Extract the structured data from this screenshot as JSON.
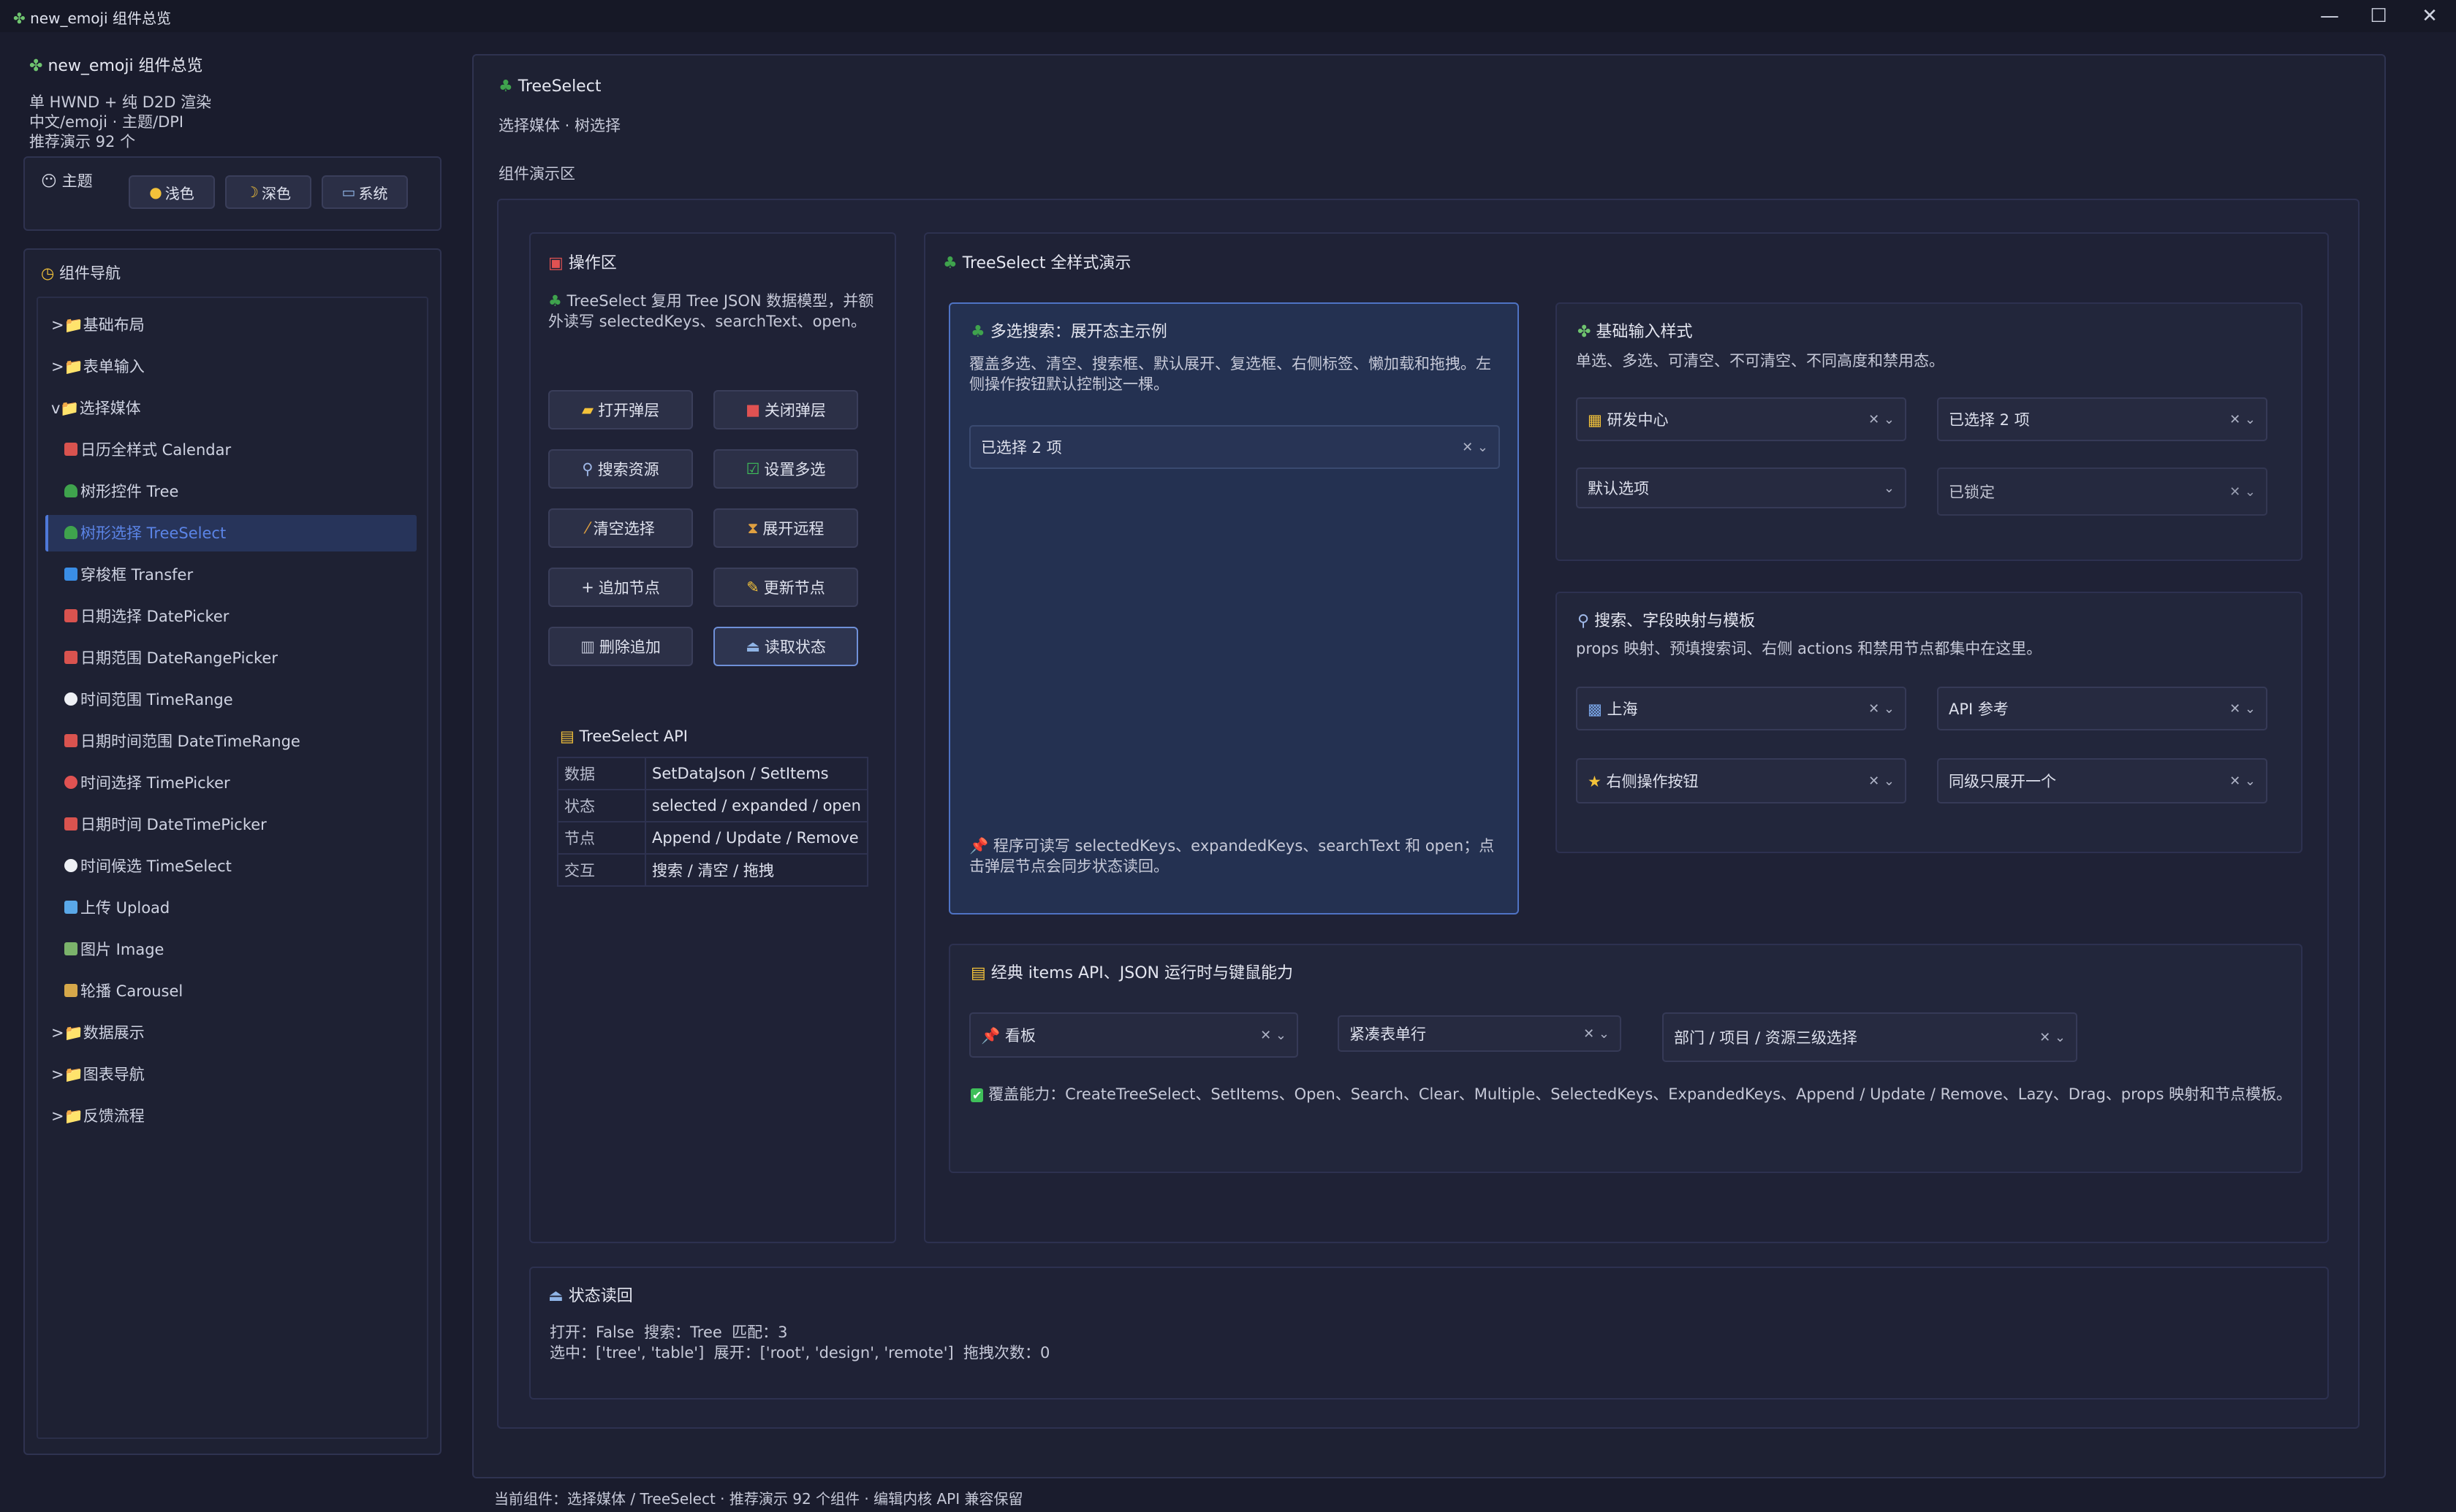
{
  "window": {
    "title": "new_emoji 组件总览",
    "controls": {
      "minimize": "—",
      "maximize": "☐",
      "close": "✕"
    }
  },
  "sidebar": {
    "app_title": "new_emoji 组件总览",
    "subtitle_lines": [
      "单 HWND + 纯 D2D 渲染",
      "中文/emoji · 主题/DPI",
      "推荐演示 92 个"
    ],
    "theme": {
      "label": "主题",
      "options": [
        "浅色",
        "深色",
        "系统"
      ]
    },
    "nav": {
      "title": "组件导航",
      "items": [
        {
          "label": ">📁基础布局",
          "level": 0
        },
        {
          "label": ">📁表单输入",
          "level": 0
        },
        {
          "label": "v📁选择媒体",
          "level": 0
        },
        {
          "label": "日历全样式 Calendar",
          "level": 1,
          "icon": "calendar-icon"
        },
        {
          "label": "树形控件 Tree",
          "level": 1,
          "icon": "tree-icon"
        },
        {
          "label": "树形选择 TreeSelect",
          "level": 1,
          "icon": "tree-icon",
          "selected": true
        },
        {
          "label": "穿梭框 Transfer",
          "level": 1,
          "icon": "transfer-icon"
        },
        {
          "label": "日期选择 DatePicker",
          "level": 1,
          "icon": "calendar-icon"
        },
        {
          "label": "日期范围 DateRangePicker",
          "level": 1,
          "icon": "calendar-icon"
        },
        {
          "label": "时间范围 TimeRange",
          "level": 1,
          "icon": "clock-icon"
        },
        {
          "label": "日期时间范围 DateTimeRange",
          "level": 1,
          "icon": "calendar-icon"
        },
        {
          "label": "时间选择 TimePicker",
          "level": 1,
          "icon": "alarm-icon"
        },
        {
          "label": "日期时间 DateTimePicker",
          "level": 1,
          "icon": "calendar-icon"
        },
        {
          "label": "时间候选 TimeSelect",
          "level": 1,
          "icon": "clock-icon"
        },
        {
          "label": "上传 Upload",
          "level": 1,
          "icon": "upload-icon"
        },
        {
          "label": "图片 Image",
          "level": 1,
          "icon": "image-icon"
        },
        {
          "label": "轮播 Carousel",
          "level": 1,
          "icon": "carousel-icon"
        },
        {
          "label": ">📁数据展示",
          "level": 0
        },
        {
          "label": ">📁图表导航",
          "level": 0
        },
        {
          "label": ">📁反馈流程",
          "level": 0
        }
      ]
    }
  },
  "main": {
    "title": "TreeSelect",
    "subtitle": "选择媒体 · 树选择",
    "demo_area_label": "组件演示区",
    "ops": {
      "title": "操作区",
      "desc": "TreeSelect 复用 Tree JSON 数据模型，并额外读写 selectedKeys、searchText、open。",
      "buttons": [
        "打开弹层",
        "关闭弹层",
        "搜索资源",
        "设置多选",
        "清空选择",
        "展开远程",
        "追加节点",
        "更新节点",
        "删除追加",
        "读取状态"
      ],
      "api": {
        "title": "TreeSelect API",
        "rows": [
          [
            "数据",
            "SetDataJson / SetItems"
          ],
          [
            "状态",
            "selected / expanded / open"
          ],
          [
            "节点",
            "Append / Update / Remove"
          ],
          [
            "交互",
            "搜索 / 清空 / 拖拽"
          ]
        ]
      }
    },
    "demo": {
      "title": "TreeSelect 全样式演示",
      "multi": {
        "title": "多选搜索：展开态主示例",
        "desc": "覆盖多选、清空、搜索框、默认展开、复选框、右侧标签、懒加载和拖拽。左侧操作按钮默认控制这一棵。",
        "value": "已选择 2 项",
        "footer": "程序可读写 selectedKeys、expandedKeys、searchText 和 open；点击弹层节点会同步状态读回。"
      },
      "basic": {
        "title": "基础输入样式",
        "desc": "单选、多选、可清空、不可清空、不同高度和禁用态。",
        "selects": [
          "研发中心",
          "已选择 2 项",
          "默认选项",
          "已锁定"
        ]
      },
      "search": {
        "title": "搜索、字段映射与模板",
        "desc": "props 映射、预填搜索词、右侧 actions 和禁用节点都集中在这里。",
        "selects": [
          "上海",
          "API 参考",
          "右侧操作按钮",
          "同级只展开一个"
        ]
      },
      "classic": {
        "title": "经典 items API、JSON 运行时与键鼠能力",
        "selects": [
          "看板",
          "紧凑表单行",
          "部门 / 项目 / 资源三级选择"
        ],
        "coverage": "覆盖能力：CreateTreeSelect、SetItems、Open、Search、Clear、Multiple、SelectedKeys、ExpandedKeys、Append / Update / Remove、Lazy、Drag、props 映射和节点模板。"
      }
    },
    "state": {
      "title": "状态读回",
      "line1": "打开：False  搜索：Tree  匹配：3",
      "line2": "选中：['tree', 'table']  展开：['root', 'design', 'remote']  拖拽次数：0"
    }
  },
  "statusbar": "当前组件：选择媒体 / TreeSelect · 推荐演示 92 个组件 · 编辑内核 API 兼容保留",
  "colors": {
    "bg": "#1a1c2d",
    "panel": "#1e2133",
    "accent": "#5b84e6",
    "selected_bg": "#27345a",
    "highlight_border": "#4f73c4"
  }
}
